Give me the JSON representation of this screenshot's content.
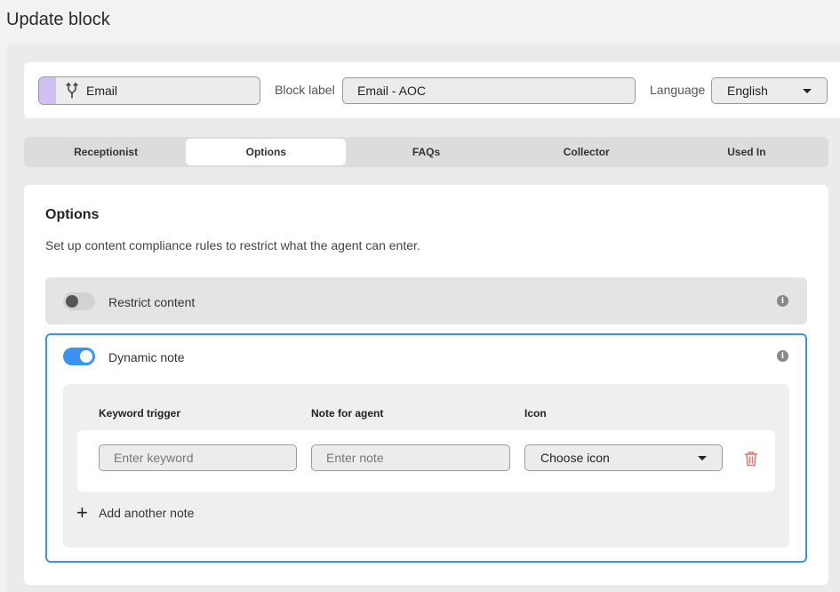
{
  "page": {
    "title": "Update block"
  },
  "block": {
    "type_label": "Email",
    "type_icon": "fork-icon",
    "accent_color": "#cfc0f2",
    "label_caption": "Block label",
    "label_value": "Email - AOC",
    "language_caption": "Language",
    "language_value": "English"
  },
  "tabs": [
    {
      "label": "Receptionist",
      "active": false
    },
    {
      "label": "Options",
      "active": true
    },
    {
      "label": "FAQs",
      "active": false
    },
    {
      "label": "Collector",
      "active": false
    },
    {
      "label": "Used In",
      "active": false
    }
  ],
  "options": {
    "title": "Options",
    "description": "Set up content compliance rules to restrict what the agent can enter.",
    "restrict_content": {
      "label": "Restrict content",
      "enabled": false
    },
    "dynamic_note": {
      "label": "Dynamic note",
      "enabled": true,
      "accent_color": "#3b93f0",
      "columns": {
        "keyword": "Keyword trigger",
        "note": "Note for agent",
        "icon": "Icon"
      },
      "row": {
        "keyword_placeholder": "Enter keyword",
        "note_placeholder": "Enter note",
        "icon_value": "Choose icon"
      },
      "add_label": "Add another note"
    }
  }
}
